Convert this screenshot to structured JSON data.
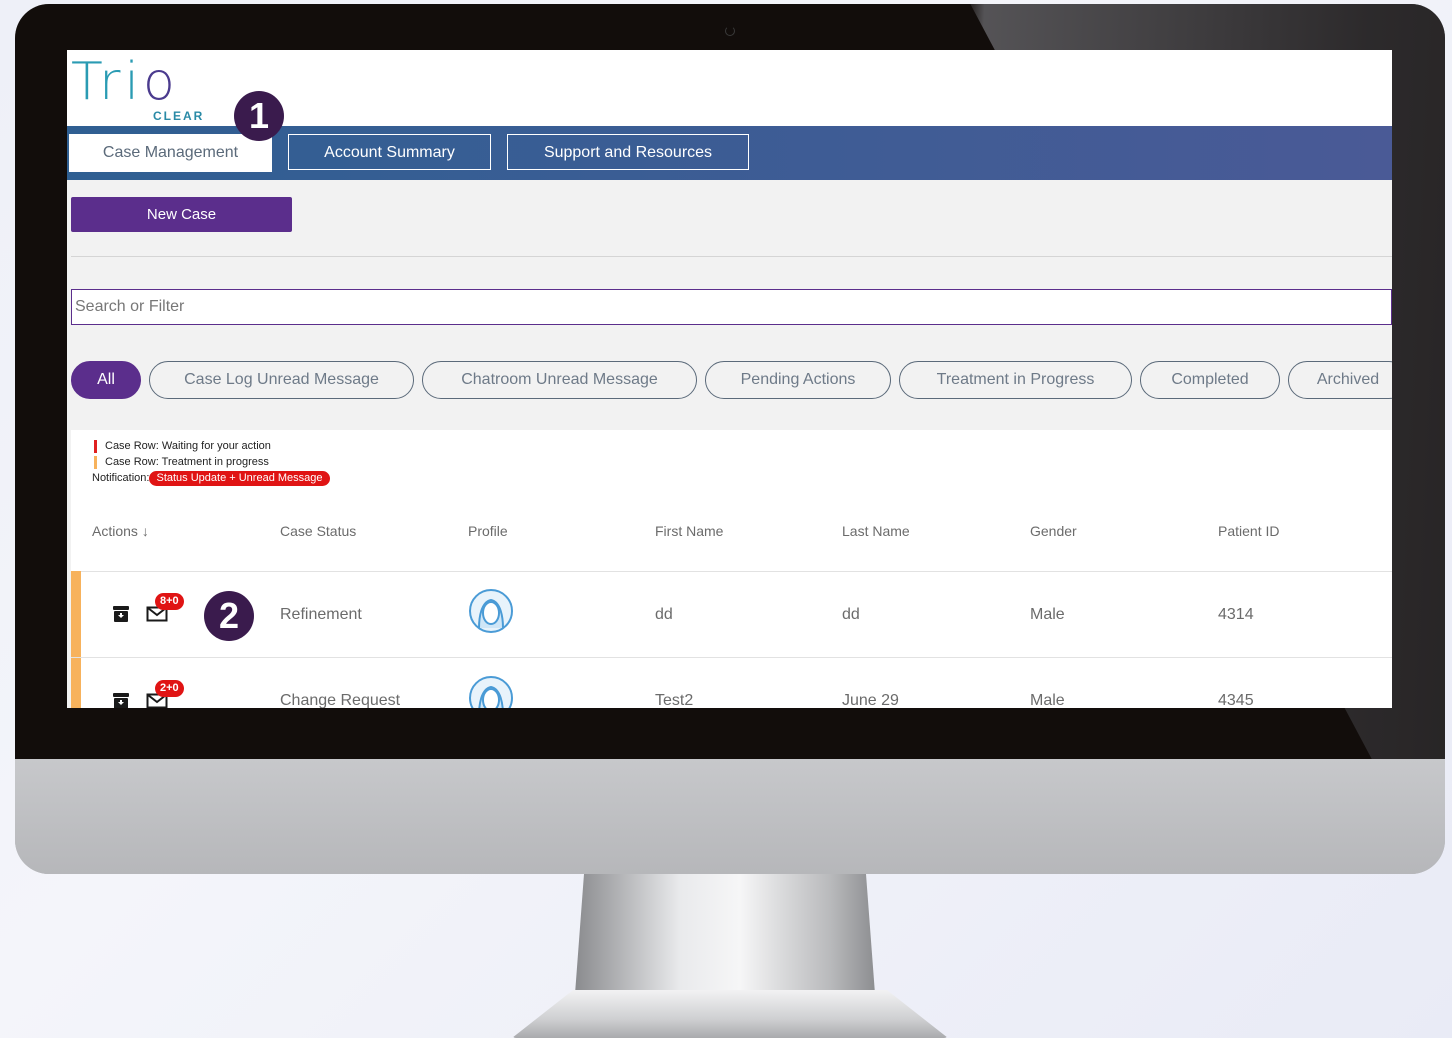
{
  "logo": {
    "text_left": "Tri",
    "text_right": "o",
    "subtitle": "CLEAR"
  },
  "markers": {
    "one": "1",
    "two": "2"
  },
  "nav": {
    "tabs": [
      {
        "label": "Case Management",
        "active": true
      },
      {
        "label": "Account Summary",
        "active": false
      },
      {
        "label": "Support and Resources",
        "active": false
      }
    ]
  },
  "actions": {
    "new_case_label": "New Case"
  },
  "search": {
    "placeholder": "Search or Filter"
  },
  "filters": [
    {
      "label": "All",
      "active": true
    },
    {
      "label": "Case Log Unread Message"
    },
    {
      "label": "Chatroom Unread Message"
    },
    {
      "label": "Pending Actions"
    },
    {
      "label": "Treatment in Progress"
    },
    {
      "label": "Completed"
    },
    {
      "label": "Archived"
    }
  ],
  "legend": {
    "row1": "Case Row: Waiting for your action",
    "row2": "Case Row: Treatment in progress",
    "notification_label": "Notification:",
    "notification_badge": "Status Update + Unread Message",
    "colors": {
      "waiting": "#e02020",
      "in_progress": "#f7b25c",
      "badge": "#e01414"
    }
  },
  "table": {
    "headers": {
      "actions": "Actions",
      "sort_icon": "↓",
      "case_status": "Case Status",
      "profile": "Profile",
      "first_name": "First Name",
      "last_name": "Last Name",
      "gender": "Gender",
      "patient_id": "Patient ID"
    },
    "rows": [
      {
        "badge": "8+0",
        "case_status": "Refinement",
        "first_name": "dd",
        "last_name": "dd",
        "gender": "Male",
        "patient_id": "4314"
      },
      {
        "badge": "2+0",
        "case_status": "Change Request",
        "first_name": "Test2",
        "last_name": "June 29",
        "gender": "Male",
        "patient_id": "4345"
      }
    ]
  },
  "colors": {
    "primary_purple": "#5b2e8c",
    "nav_blue": "#3f5c95",
    "logo_teal": "#2a9bb3",
    "row_accent": "#f7b25c"
  }
}
